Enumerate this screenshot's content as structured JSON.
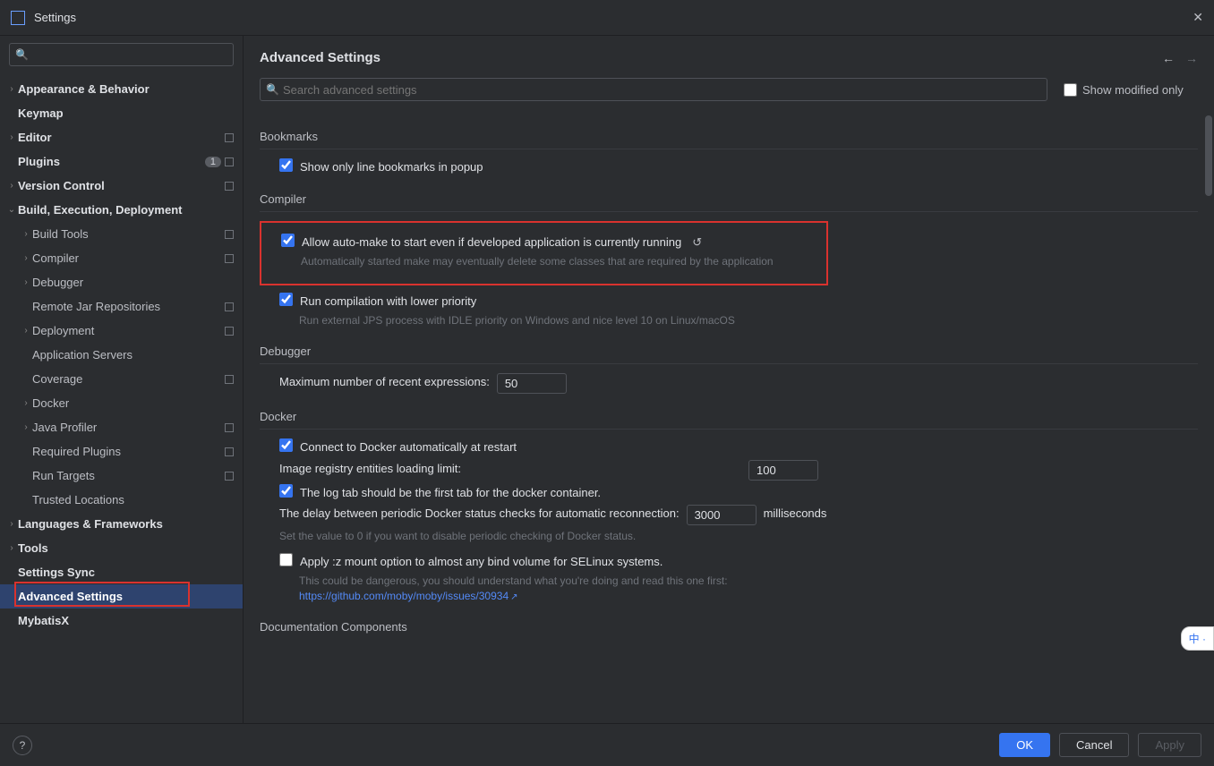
{
  "window": {
    "title": "Settings"
  },
  "sidebar": {
    "search_placeholder": "",
    "items": [
      {
        "label": "Appearance & Behavior",
        "bold": true,
        "arrow": "›",
        "depth": 0
      },
      {
        "label": "Keymap",
        "bold": true,
        "depth": 0
      },
      {
        "label": "Editor",
        "bold": true,
        "arrow": "›",
        "depth": 0,
        "trail": "sq"
      },
      {
        "label": "Plugins",
        "bold": true,
        "depth": 0,
        "badge": "1",
        "trail": "sq"
      },
      {
        "label": "Version Control",
        "bold": true,
        "arrow": "›",
        "depth": 0,
        "trail": "sq"
      },
      {
        "label": "Build, Execution, Deployment",
        "bold": true,
        "arrow": "v",
        "depth": 0
      },
      {
        "label": "Build Tools",
        "arrow": "›",
        "depth": 1,
        "trail": "sq"
      },
      {
        "label": "Compiler",
        "arrow": "›",
        "depth": 1,
        "trail": "sq"
      },
      {
        "label": "Debugger",
        "arrow": "›",
        "depth": 1
      },
      {
        "label": "Remote Jar Repositories",
        "depth": 1,
        "trail": "sq"
      },
      {
        "label": "Deployment",
        "arrow": "›",
        "depth": 1,
        "trail": "sq"
      },
      {
        "label": "Application Servers",
        "depth": 1
      },
      {
        "label": "Coverage",
        "depth": 1,
        "trail": "sq"
      },
      {
        "label": "Docker",
        "arrow": "›",
        "depth": 1
      },
      {
        "label": "Java Profiler",
        "arrow": "›",
        "depth": 1,
        "trail": "sq"
      },
      {
        "label": "Required Plugins",
        "depth": 1,
        "trail": "sq"
      },
      {
        "label": "Run Targets",
        "depth": 1,
        "trail": "sq"
      },
      {
        "label": "Trusted Locations",
        "depth": 1
      },
      {
        "label": "Languages & Frameworks",
        "bold": true,
        "arrow": "›",
        "depth": 0
      },
      {
        "label": "Tools",
        "bold": true,
        "arrow": "›",
        "depth": 0
      },
      {
        "label": "Settings Sync",
        "bold": true,
        "depth": 0
      },
      {
        "label": "Advanced Settings",
        "bold": true,
        "depth": 0,
        "selected": true
      },
      {
        "label": "MybatisX",
        "bold": true,
        "depth": 0
      }
    ]
  },
  "header": {
    "title": "Advanced Settings"
  },
  "filter": {
    "placeholder": "Search advanced settings",
    "show_modified_label": "Show modified only"
  },
  "sections": {
    "bookmarks": {
      "title": "Bookmarks",
      "opt1": "Show only line bookmarks in popup"
    },
    "compiler": {
      "title": "Compiler",
      "opt1": "Allow auto-make to start even if developed application is currently running",
      "desc1": "Automatically started make may eventually delete some classes that are required by the application",
      "opt2": "Run compilation with lower priority",
      "desc2": "Run external JPS process with IDLE priority on Windows and nice level 10 on Linux/macOS"
    },
    "debugger": {
      "title": "Debugger",
      "field1_label": "Maximum number of recent expressions:",
      "field1_value": "50"
    },
    "docker": {
      "title": "Docker",
      "opt1": "Connect to Docker automatically at restart",
      "field1_label": "Image registry entities loading limit:",
      "field1_value": "100",
      "opt2": "The log tab should be the first tab for the docker container.",
      "field2_label": "The delay between periodic Docker status checks for automatic reconnection:",
      "field2_value": "3000",
      "field2_suffix": "milliseconds",
      "desc2": "Set the value to 0 if you want to disable periodic checking of Docker status.",
      "opt3": "Apply :z mount option to almost any bind volume for SELinux systems.",
      "desc3": "This could be dangerous, you should understand what you're doing and read this one first:",
      "link3": "https://github.com/moby/moby/issues/30934"
    },
    "doc": {
      "title": "Documentation Components"
    }
  },
  "footer": {
    "ok": "OK",
    "cancel": "Cancel",
    "apply": "Apply"
  },
  "ime": "中"
}
